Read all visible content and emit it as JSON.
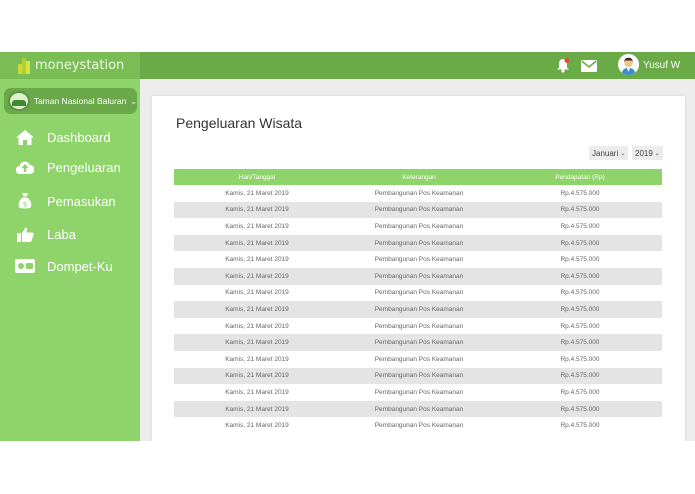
{
  "brand": {
    "name": "moneystation"
  },
  "park": {
    "name": "Taman Nasional Baluran",
    "chevron_icon": "chevron-down-icon"
  },
  "nav": [
    {
      "label": "Dashboard",
      "icon": "home-icon"
    },
    {
      "label": "Pengeluaran",
      "icon": "cloud-upload-icon"
    },
    {
      "label": "Pemasukan",
      "icon": "money-bag-icon"
    },
    {
      "label": "Laba",
      "icon": "thumbs-up-icon"
    },
    {
      "label": "Dompet-Ku",
      "icon": "wallet-icon"
    }
  ],
  "topbar": {
    "notification_icon": "bell-icon",
    "notification_count": "1",
    "mail_icon": "envelope-icon",
    "user_name": "Yusuf W"
  },
  "page": {
    "title": "Pengeluaran Wisata",
    "month_filter": "Januari",
    "year_filter": "2019"
  },
  "table": {
    "headers": [
      "Hari/Tanggal",
      "Keterangan",
      "Pendapatan (Rp)"
    ],
    "rows": [
      [
        "Kamis, 21 Maret 2019",
        "Pembangunan Pos Keamanan",
        "Rp.4.575.000"
      ],
      [
        "Kamis, 21 Maret 2019",
        "Pembangunan Pos Keamanan",
        "Rp.4.575.000"
      ],
      [
        "Kamis, 21 Maret 2019",
        "Pembangunan Pos Keamanan",
        "Rp.4.575.000"
      ],
      [
        "Kamis, 21 Maret 2019",
        "Pembangunan Pos Keamanan",
        "Rp.4.575.000"
      ],
      [
        "Kamis, 21 Maret 2019",
        "Pembangunan Pos Keamanan",
        "Rp.4.575.000"
      ],
      [
        "Kamis, 21 Maret 2019",
        "Pembangunan Pos Keamanan",
        "Rp.4.575.000"
      ],
      [
        "Kamis, 21 Maret 2019",
        "Pembangunan Pos Keamanan",
        "Rp.4.575.000"
      ],
      [
        "Kamis, 21 Maret 2019",
        "Pembangunan Pos Keamanan",
        "Rp.4.575.000"
      ],
      [
        "Kamis, 21 Maret 2019",
        "Pembangunan Pos Keamanan",
        "Rp.4.575.000"
      ],
      [
        "Kamis, 21 Maret 2019",
        "Pembangunan Pos Keamanan",
        "Rp.4.575.000"
      ],
      [
        "Kamis, 21 Maret 2019",
        "Pembangunan Pos Keamanan",
        "Rp.4.575.000"
      ],
      [
        "Kamis, 21 Maret 2019",
        "Pembangunan Pos Keamanan",
        "Rp.4.575.000"
      ],
      [
        "Kamis, 21 Maret 2019",
        "Pembangunan Pos Keamanan",
        "Rp.4.575.000"
      ],
      [
        "Kamis, 21 Maret 2019",
        "Pembangunan Pos Keamanan",
        "Rp.4.575.000"
      ],
      [
        "Kamis, 21 Maret 2019",
        "Pembangunan Pos Keamanan",
        "Rp.4.575.000"
      ]
    ]
  },
  "colors": {
    "sidebar": "#8fd36b",
    "topbar": "#6aaa47",
    "table_header": "#8fd36b",
    "row_alt": "#e4e4e4"
  }
}
